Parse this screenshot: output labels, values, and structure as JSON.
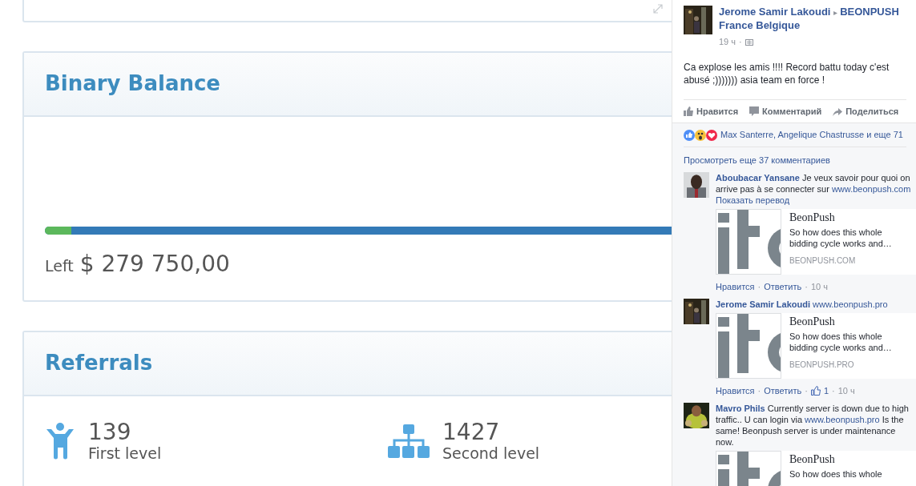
{
  "top_card": {
    "expandable": true
  },
  "balance": {
    "title": "Binary Balance",
    "level": 0.031,
    "left_label": "Left",
    "left_amount": "$ 279 750,00"
  },
  "referrals": {
    "title": "Referrals",
    "stats": [
      {
        "kind": "person",
        "value": "139",
        "label": "First level"
      },
      {
        "kind": "tree",
        "value": "1427",
        "label": "Second level"
      }
    ]
  },
  "post": {
    "author": "Jerome Samir Lakoudi",
    "arrow": "▸",
    "group": "BEONPUSH France Belgique",
    "time": "19 ч",
    "text": "Ca explose les amis !!!! Record battu today c'est abusé ;))))))) asia team en force !",
    "actions": [
      {
        "kind": "like",
        "label": "Нравится"
      },
      {
        "kind": "comment",
        "label": "Комментарий"
      },
      {
        "kind": "share",
        "label": "Поделиться"
      }
    ],
    "separator": "·",
    "reactions": [
      {
        "kind": "like"
      },
      {
        "kind": "wow"
      },
      {
        "kind": "love"
      }
    ],
    "reacted_by": "Max Santerre, Angelique Chastrusse и еще 71",
    "more_comments": "Просмотреть еще 37 комментариев",
    "comments": [
      {
        "author": "Aboubacar Yansane",
        "text": "Je veux savoir pour quoi on arrive pas à se connecter sur",
        "link": "www.beonpush.com",
        "translate": "Показать перевод",
        "preview": {
          "title": "BeonPush",
          "desc": "So how does this whole bidding cycle works and…",
          "domain": "BEONPUSH.COM"
        },
        "like": "Нравится",
        "reply": "Ответить",
        "time": "10 ч"
      },
      {
        "author": "Jerome Samir Lakoudi",
        "link": "www.beonpush.pro",
        "preview": {
          "title": "BeonPush",
          "desc": "So how does this whole bidding cycle works and…",
          "domain": "BEONPUSH.PRO"
        },
        "like": "Нравится",
        "reply": "Ответить",
        "likes": "1",
        "time": "10 ч"
      },
      {
        "author": "Mavro Phils",
        "text": "Currently server is down due to high traffic.. U can login via",
        "link": "www.beonpush.pro",
        "text_after": "Is the same! Beonpush server is under maintenance now.",
        "preview": {
          "title": "BeonPush",
          "desc": "So how does this whole"
        }
      }
    ]
  }
}
